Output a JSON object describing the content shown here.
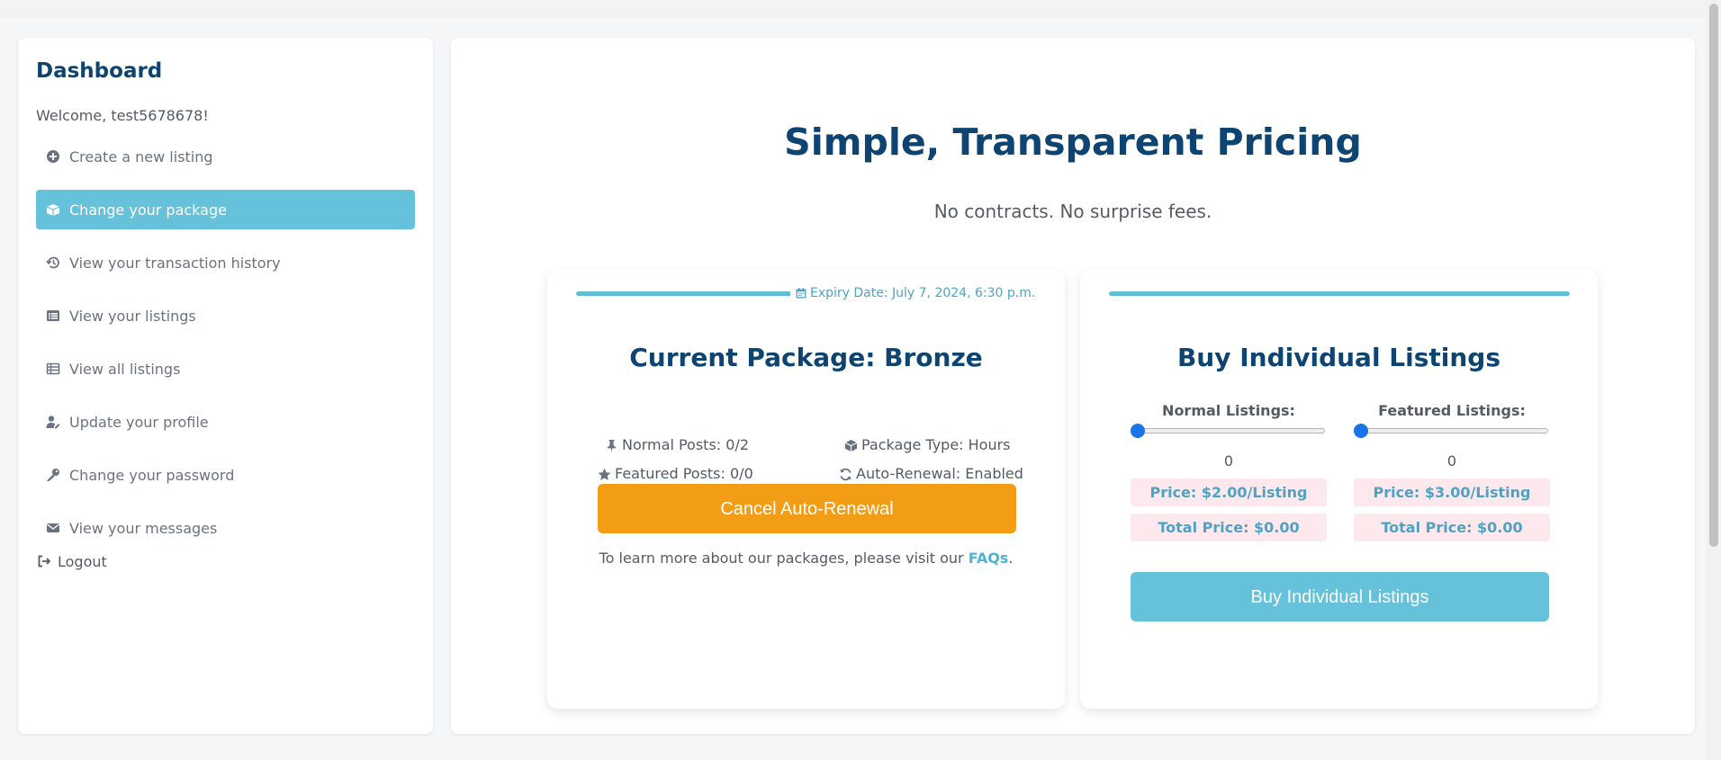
{
  "sidebar": {
    "title": "Dashboard",
    "welcome": "Welcome, test5678678!",
    "items": [
      {
        "label": "Create a new listing",
        "icon": "plus-circle-icon",
        "active": false
      },
      {
        "label": "Change your package",
        "icon": "box-open-icon",
        "active": true
      },
      {
        "label": "View your transaction history",
        "icon": "history-icon",
        "active": false
      },
      {
        "label": "View your listings",
        "icon": "list-alt-icon",
        "active": false
      },
      {
        "label": "View all listings",
        "icon": "table-list-icon",
        "active": false
      },
      {
        "label": "Update your profile",
        "icon": "user-edit-icon",
        "active": false
      },
      {
        "label": "Change your password",
        "icon": "key-icon",
        "active": false
      },
      {
        "label": "View your messages",
        "icon": "envelope-icon",
        "active": false
      }
    ],
    "logout": "Logout"
  },
  "main": {
    "title": "Simple, Transparent Pricing",
    "subtitle": "No contracts. No surprise fees."
  },
  "current_package": {
    "expiry": "Expiry Date: July 7, 2024, 6:30 p.m.",
    "title": "Current Package: Bronze",
    "normal_posts": "Normal Posts: 0/2",
    "package_type": "Package Type: Hours",
    "featured_posts": "Featured Posts: 0/0",
    "auto_renewal": "Auto-Renewal: Enabled",
    "cancel_button": "Cancel Auto-Renewal",
    "faq_text": "To learn more about our packages, please visit our ",
    "faq_link": "FAQs",
    "faq_end": "."
  },
  "buy_listings": {
    "title": "Buy Individual Listings",
    "normal": {
      "label": "Normal Listings:",
      "value": "0",
      "slider_fraction": 0,
      "price": "Price: $2.00/Listing",
      "total": "Total Price: $0.00"
    },
    "featured": {
      "label": "Featured Listings:",
      "value": "0",
      "slider_fraction": 0,
      "price": "Price: $3.00/Listing",
      "total": "Total Price: $0.00"
    },
    "buy_button": "Buy Individual Listings"
  },
  "colors": {
    "accent": "#66c1da",
    "heading": "#0d4471",
    "orange": "#f39c15",
    "price_bg": "#fde8ee",
    "slider_thumb": "#1a73e8"
  }
}
